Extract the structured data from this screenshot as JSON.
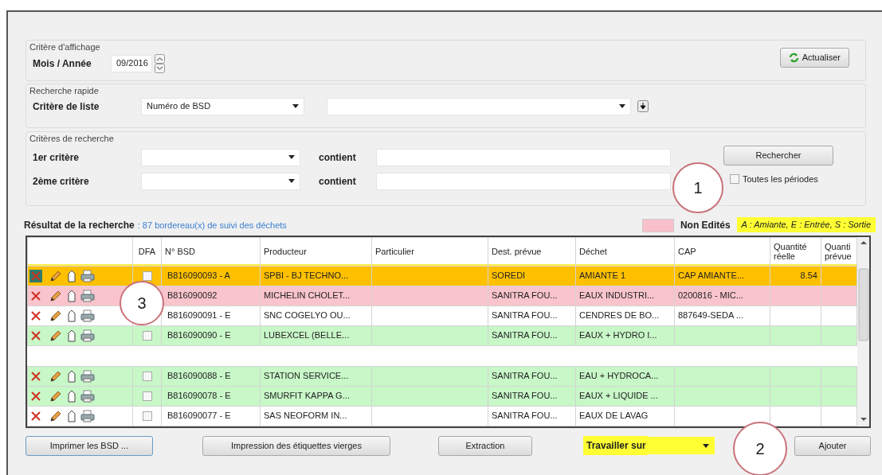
{
  "display_criteria": {
    "legend": "Critère d'affichage",
    "month_label": "Mois / Année",
    "month_value": "09/2016",
    "refresh_button": "Actualiser"
  },
  "quick_search": {
    "legend": "Recherche rapide",
    "list_label": "Critère de liste",
    "list_value": "Numéro de BSD"
  },
  "search_criteria": {
    "legend": "Critères de recherche",
    "criteria": [
      {
        "label": "1er critère",
        "operator": "contient"
      },
      {
        "label": "2ème critère",
        "operator": "contient"
      }
    ],
    "search_button": "Rechercher",
    "all_periods": {
      "label": "Toutes les périodes",
      "checked": false
    }
  },
  "results": {
    "title": "Résultat de la recherche",
    "count": ": 87 bordereau(x) de suivi des déchets",
    "legend": {
      "color": "#f9c0cb",
      "label": "Non Edités"
    },
    "code_legend": "A : Amiante, E : Entrée, S : Sortie"
  },
  "table": {
    "columns": [
      "DFA",
      "N° BSD",
      "Producteur",
      "Particulier",
      "Dest. prévue",
      "Déchet",
      "CAP",
      "Quantité réelle",
      "Quanti prévue"
    ],
    "row_groups": [
      [
        {
          "selected": true,
          "color": "#ffc000",
          "dfa_checked": false,
          "bsd": "B816090093 - A",
          "producer": "SPBI - BJ TECHNO...",
          "destination": "SOREDI",
          "waste": "AMIANTE 1",
          "cap": "CAP AMIANTE...",
          "quantity_real": "8.54"
        },
        {
          "selected": false,
          "color": "#f9c4cc",
          "bsd": "B816090092",
          "producer": "MICHELIN CHOLET...",
          "destination": "SANITRA FOU...",
          "waste": "EAUX INDUSTRI...",
          "cap": "0200816 - MIC..."
        },
        {
          "selected": false,
          "color": "#ffffff",
          "bsd": "B816090091 - E",
          "producer": "SNC COGELYO OU...",
          "destination": "SANITRA FOU...",
          "waste": "CENDRES DE BO...",
          "cap": "887649-SEDA ..."
        },
        {
          "selected": false,
          "color": "#c8f7c8",
          "dfa_checked": false,
          "bsd": "B816090090 - E",
          "producer": "LUBEXCEL (BELLE...",
          "destination": "SANITRA FOU...",
          "waste": "EAUX + HYDRO I..."
        }
      ],
      [
        {
          "selected": false,
          "color": "#c8f7c8",
          "dfa_checked": false,
          "bsd": "B816090088 - E",
          "producer": "STATION SERVICE...",
          "destination": "SANITRA FOU...",
          "waste": "EAU + HYDROCA..."
        },
        {
          "selected": false,
          "color": "#c8f7c8",
          "dfa_checked": false,
          "bsd": "B816090078 - E",
          "producer": "SMURFIT KAPPA G...",
          "destination": "SANITRA FOU...",
          "waste": "EAUX + LIQUIDE ..."
        },
        {
          "selected": false,
          "color": "#ffffff",
          "dfa_checked": false,
          "bsd": "B816090077 - E",
          "producer": "SAS NEOFORM IN...",
          "destination": "SANITRA FOU...",
          "waste": "EAUX DE LAVAG"
        }
      ]
    ]
  },
  "footer": {
    "print_button": "Imprimer les BSD ...",
    "labels_button": "Impression des étiquettes vierges",
    "export_button": "Extraction",
    "work_on_label": "Travailler sur",
    "add_button": "Ajouter"
  },
  "callouts": [
    {
      "label": "1"
    },
    {
      "label": "2"
    },
    {
      "label": "3"
    }
  ]
}
